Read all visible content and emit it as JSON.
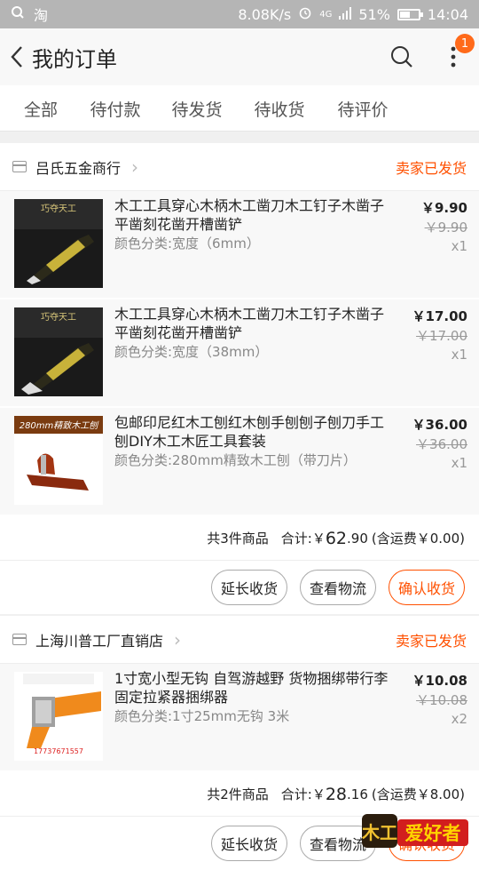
{
  "status_bar": {
    "app": "淘",
    "speed": "8.08K/s",
    "network": "4G",
    "battery": "51%",
    "battery_level": 0.51,
    "time": "14:04"
  },
  "header": {
    "title": "我的订单",
    "badge": "1"
  },
  "tabs": [
    {
      "label": "全部"
    },
    {
      "label": "待付款"
    },
    {
      "label": "待发货"
    },
    {
      "label": "待收货"
    },
    {
      "label": "待评价"
    }
  ],
  "active_tab": "待收货",
  "orders": [
    {
      "shop": "吕氏五金商行",
      "status": "卖家已发货",
      "items": [
        {
          "title": "木工工具穿心木柄木工凿刀木工钉子木凿子平凿刻花凿开槽凿铲",
          "spec": "颜色分类:宽度（6mm）",
          "price": "￥9.90",
          "original_price": "￥9.90",
          "qty": "x1",
          "thumb_text": "巧夺天工"
        },
        {
          "title": "木工工具穿心木柄木工凿刀木工钉子木凿子平凿刻花凿开槽凿铲",
          "spec": "颜色分类:宽度（38mm）",
          "price": "￥17.00",
          "original_price": "￥17.00",
          "qty": "x1",
          "thumb_text": "巧夺天工"
        },
        {
          "title": "包邮印尼红木工刨红木刨手刨刨子刨刀手工刨DIY木工木匠工具套装",
          "spec": "颜色分类:280mm精致木工刨（带刀片）",
          "price": "￥36.00",
          "original_price": "￥36.00",
          "qty": "x1",
          "thumb_text": "280mm精致木工刨"
        }
      ],
      "summary": {
        "count": "共3件商品",
        "label": "合计:",
        "currency": "￥",
        "int": "62",
        "dec": ".90",
        "shipping": "(含运费￥0.00)"
      },
      "buttons": [
        "延长收货",
        "查看物流",
        "确认收货"
      ]
    },
    {
      "shop": "上海川普工厂直销店",
      "status": "卖家已发货",
      "items": [
        {
          "title": "1寸宽小型无钩  自驾游越野 货物捆绑带行李固定拉紧器捆绑器",
          "spec": "颜色分类:1寸25mm无钩 3米",
          "price": "￥10.08",
          "original_price": "￥10.08",
          "qty": "x2",
          "thumb_text": "17737671557"
        }
      ],
      "summary": {
        "count": "共2件商品",
        "label": "合计:",
        "currency": "￥",
        "int": "28",
        "dec": ".16",
        "shipping": "(含运费￥8.00)"
      },
      "buttons": [
        "延长收货",
        "查看物流",
        "确认收货"
      ]
    }
  ],
  "watermark": {
    "text": "爱好者",
    "logo": "木工"
  },
  "colors": {
    "accent": "#ff5000",
    "badge": "#ff6a1a"
  }
}
